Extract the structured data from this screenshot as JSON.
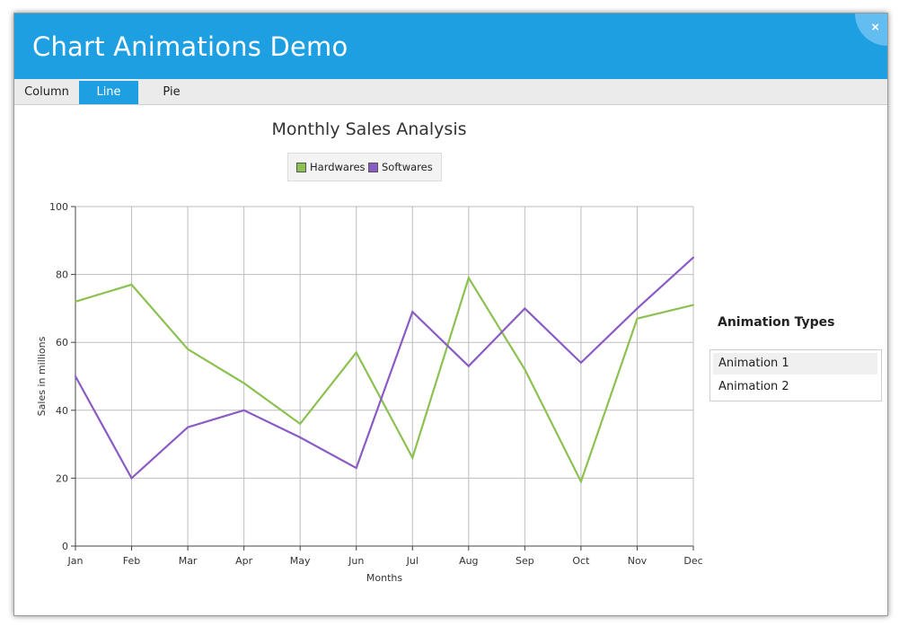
{
  "window": {
    "title": "Chart Animations Demo",
    "close_glyph": "×"
  },
  "tabs": [
    {
      "label": "Column",
      "active": false
    },
    {
      "label": "Line",
      "active": true
    },
    {
      "label": "Pie",
      "active": false
    }
  ],
  "side_panel": {
    "heading": "Animation Types",
    "items": [
      {
        "label": "Animation 1",
        "selected": true
      },
      {
        "label": "Animation 2",
        "selected": false
      }
    ]
  },
  "colors": {
    "accent": "#1e9fe1",
    "hardwares": "#8cc152",
    "softwares": "#8a5bc4"
  },
  "chart_data": {
    "type": "line",
    "title": "Monthly Sales Analysis",
    "xlabel": "Months",
    "ylabel": "Sales in millions",
    "categories": [
      "Jan",
      "Feb",
      "Mar",
      "Apr",
      "May",
      "Jun",
      "Jul",
      "Aug",
      "Sep",
      "Oct",
      "Nov",
      "Dec"
    ],
    "ylim": [
      0,
      100
    ],
    "yticks": [
      0,
      20,
      40,
      60,
      80,
      100
    ],
    "grid": true,
    "legend_position": "top",
    "series": [
      {
        "name": "Hardwares",
        "values": [
          72,
          77,
          58,
          48,
          36,
          57,
          26,
          79,
          52,
          19,
          67,
          71
        ]
      },
      {
        "name": "Softwares",
        "values": [
          50,
          20,
          35,
          40,
          32,
          23,
          69,
          53,
          70,
          54,
          70,
          85
        ]
      }
    ]
  }
}
